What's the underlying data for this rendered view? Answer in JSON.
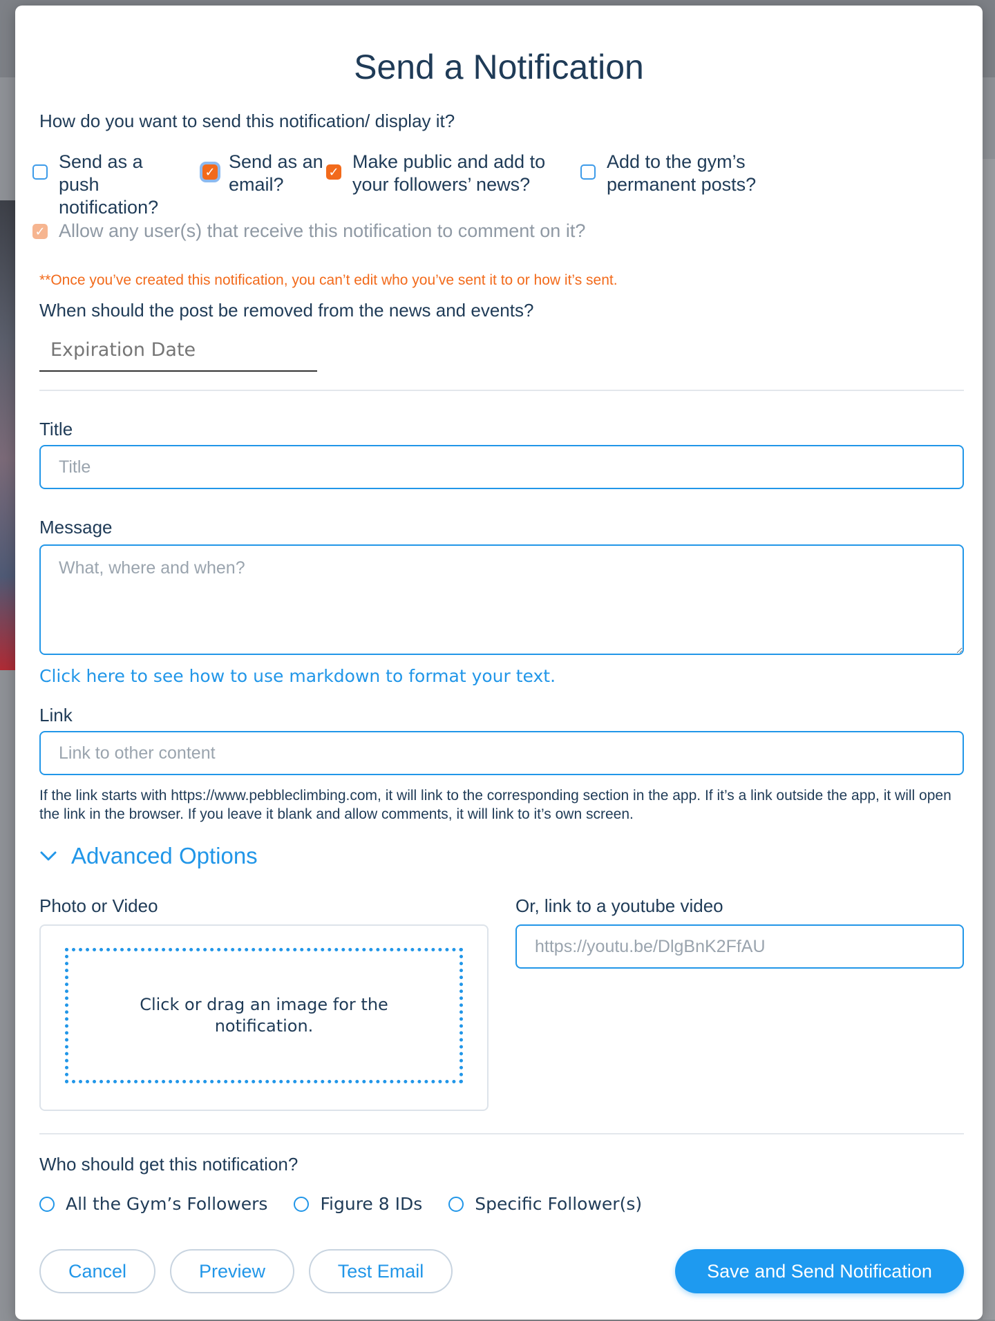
{
  "modal": {
    "title": "Send a Notification",
    "send_question": "How do you want to send this notification/ display it?",
    "options": [
      {
        "label": "Send as a push notification?",
        "checked": false
      },
      {
        "label": "Send as an email?",
        "checked": true
      },
      {
        "label": "Make public and add to your followers’ news?",
        "checked": true
      },
      {
        "label": "Add to the gym’s permanent posts?",
        "checked": false
      }
    ],
    "allow_comments": {
      "label": "Allow any user(s) that receive this notification to comment on it?",
      "checked": true,
      "disabled": true
    },
    "warning": "**Once you’ve created this notification, you can’t edit who you’ve sent it to or how it’s sent.",
    "removal_question": "When should the post be removed from the news and events?",
    "expiration_placeholder": "Expiration Date",
    "title_label": "Title",
    "title_placeholder": "Title",
    "message_label": "Message",
    "message_placeholder": "What, where and when?",
    "markdown_link": "Click here to see how to use markdown to format your text.",
    "link_label": "Link",
    "link_placeholder": "Link to other content",
    "link_help": "If the link starts with https://www.pebbleclimbing.com, it will link to the corresponding section in the app. If it’s a link outside the app, it will open the link in the browser. If you leave it blank and allow comments, it will link to it’s own screen.",
    "advanced_label": "Advanced Options",
    "photo_label": "Photo or Video",
    "dropzone_text": "Click or drag an image for the notification.",
    "youtube_label": "Or, link to a youtube video",
    "youtube_placeholder": "https://youtu.be/DlgBnK2FfAU",
    "recipients_question": "Who should get this notification?",
    "recipients": [
      "All the Gym’s Followers",
      "Figure 8 IDs",
      "Specific Follower(s)"
    ],
    "buttons": {
      "cancel": "Cancel",
      "preview": "Preview",
      "test_email": "Test Email",
      "save_send": "Save and Send Notification"
    }
  },
  "colors": {
    "accent": "#2196e8",
    "primary_button": "#1e9af0",
    "checkbox_checked": "#f26a1b",
    "warning": "#f26a1b",
    "heading": "#1f3b57"
  }
}
